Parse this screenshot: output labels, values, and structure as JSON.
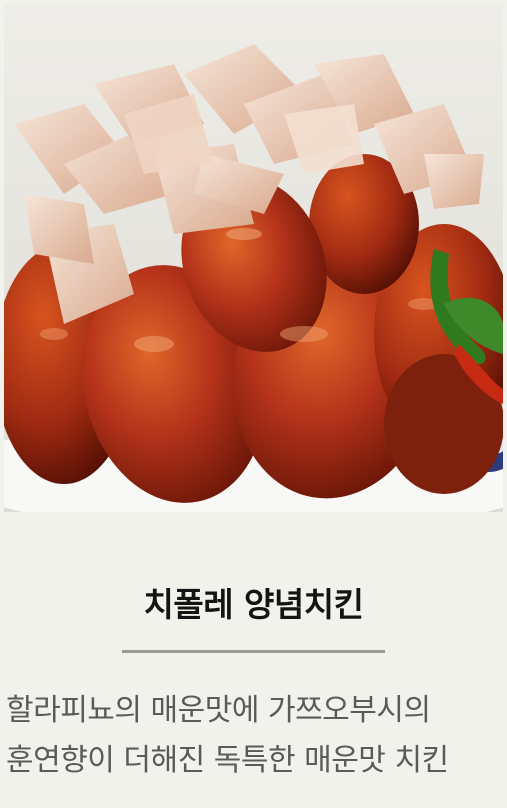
{
  "menu_item": {
    "photo_alt": "chicken-photo",
    "title": "치폴레 양념치킨",
    "description": "할라피뇨의 매운맛에 가쯔오부시의 훈연향이 더해진 독특한 매운맛 치킨"
  },
  "colors": {
    "background": "#f2f2ed",
    "title": "#141414",
    "description": "#5a5a5a",
    "divider": "#9a9a95"
  }
}
